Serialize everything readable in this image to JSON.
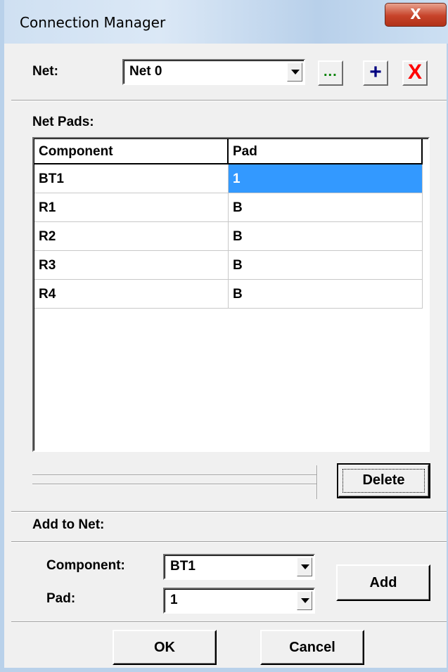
{
  "window": {
    "title": "Connection Manager",
    "close_glyph": "X"
  },
  "net": {
    "label": "Net:",
    "value": "Net 0",
    "browse_glyph": "...",
    "add_glyph": "+",
    "delete_glyph": "X",
    "colors": {
      "browse": "#008000",
      "add": "#000080",
      "delete": "#ff0000"
    }
  },
  "net_pads": {
    "label": "Net Pads:",
    "columns": [
      "Component",
      "Pad"
    ],
    "rows": [
      {
        "component": "BT1",
        "pad": "1",
        "selected": true
      },
      {
        "component": "R1",
        "pad": "B"
      },
      {
        "component": "R2",
        "pad": "B"
      },
      {
        "component": "R3",
        "pad": "B"
      },
      {
        "component": "R4",
        "pad": "B"
      }
    ],
    "delete_label": "Delete"
  },
  "add_to_net": {
    "label": "Add to Net:",
    "component_label": "Component:",
    "component_value": "BT1",
    "pad_label": "Pad:",
    "pad_value": "1",
    "add_label": "Add"
  },
  "footer": {
    "ok_label": "OK",
    "cancel_label": "Cancel"
  },
  "colors": {
    "selection": "#3399ff",
    "face": "#f0f0f0",
    "close": "#c7432a"
  }
}
